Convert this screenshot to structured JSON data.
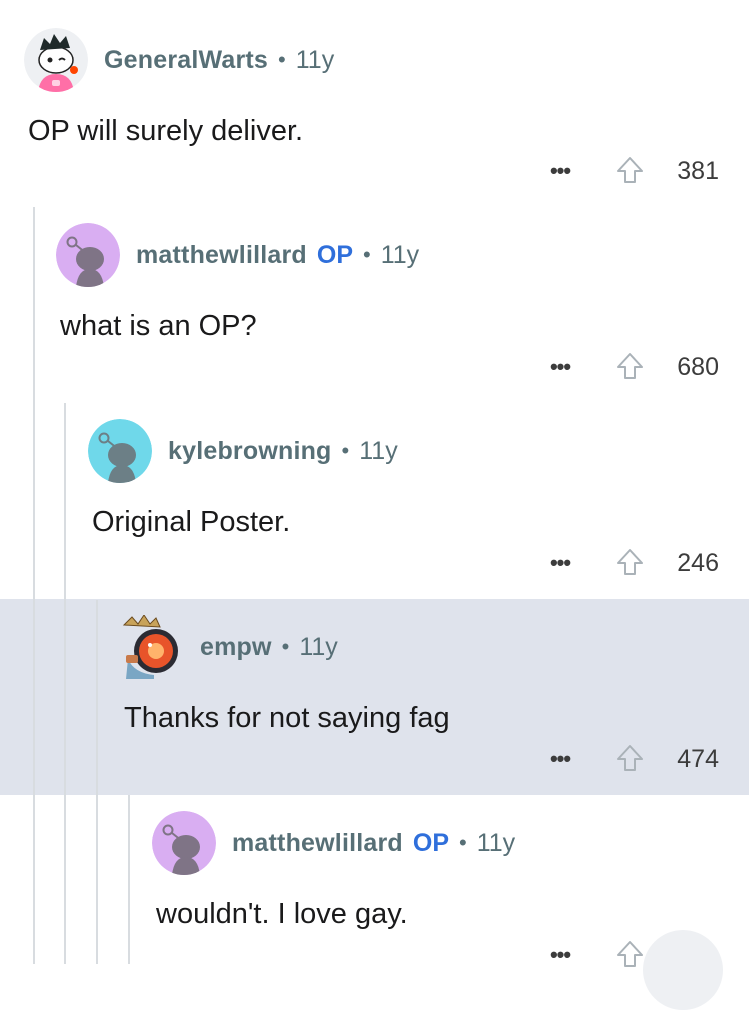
{
  "comments": [
    {
      "username": "GeneralWarts",
      "is_op": false,
      "age": "11y",
      "text": "OP will surely deliver.",
      "score": "381",
      "avatar": "snoo-hoodie-avatar"
    },
    {
      "username": "matthewlillard",
      "is_op": true,
      "op_label": "OP",
      "age": "11y",
      "text": "what is an OP?",
      "score": "680",
      "avatar": "snoo-default-purple-avatar"
    },
    {
      "username": "kylebrowning",
      "is_op": false,
      "age": "11y",
      "text": "Original Poster.",
      "score": "246",
      "avatar": "snoo-default-teal-avatar"
    },
    {
      "username": "empw",
      "is_op": false,
      "age": "11y",
      "text": "Thanks for not saying fag",
      "score": "474",
      "avatar": "snoo-robot-crown-avatar"
    },
    {
      "username": "matthewlillard",
      "is_op": true,
      "op_label": "OP",
      "age": "11y",
      "text": "wouldn't.  I love gay.",
      "score": "",
      "avatar": "snoo-default-purple-avatar"
    }
  ],
  "ui": {
    "separator": "•",
    "more_glyph": "•••",
    "highlight_color": "#dfe3ec",
    "accent_op_color": "#2f6fdb",
    "icons": {
      "more": "more-options-icon",
      "upvote": "upvote-icon"
    }
  }
}
